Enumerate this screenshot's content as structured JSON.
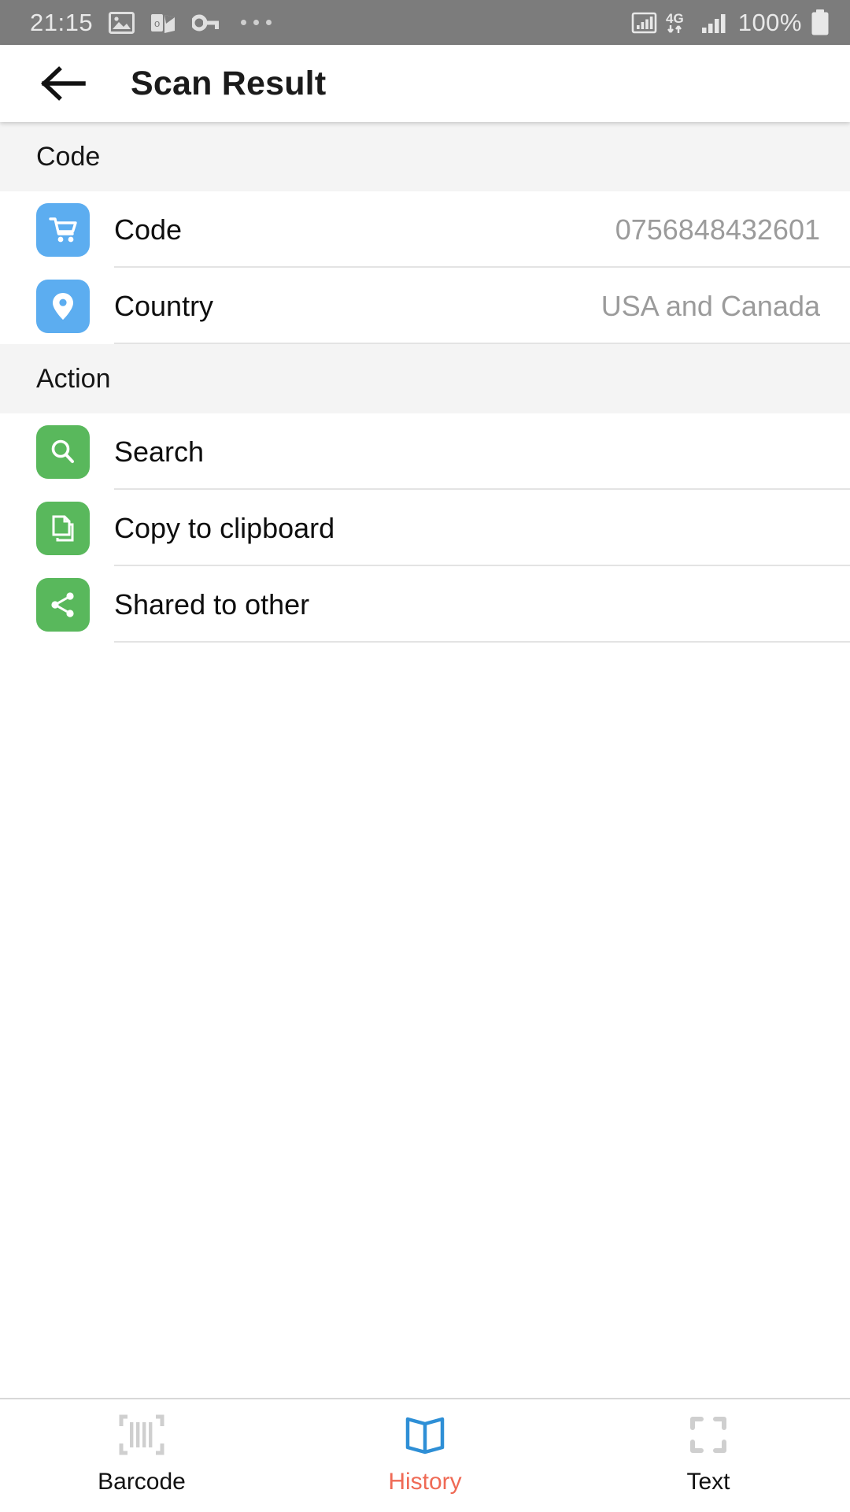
{
  "status_bar": {
    "time": "21:15",
    "battery_percent": "100%",
    "network": "4G",
    "left_icons": [
      "image-icon",
      "outlook-icon",
      "key-icon",
      "overflow-dots-icon"
    ],
    "right_icons": [
      "signal-box-icon",
      "network-4g-icon",
      "signal-bars-icon",
      "battery-icon"
    ]
  },
  "app_bar": {
    "back_label": "back-arrow",
    "title": "Scan Result"
  },
  "sections": [
    {
      "header": "Code",
      "rows": [
        {
          "icon": "shopping-cart-icon",
          "icon_color": "#5cadf0",
          "label": "Code",
          "value": "0756848432601"
        },
        {
          "icon": "location-pin-icon",
          "icon_color": "#5cadf0",
          "label": "Country",
          "value": "USA and Canada"
        }
      ]
    },
    {
      "header": "Action",
      "rows": [
        {
          "icon": "search-icon",
          "icon_color": "#59b85c",
          "label": "Search",
          "value": ""
        },
        {
          "icon": "copy-icon",
          "icon_color": "#59b85c",
          "label": "Copy to clipboard",
          "value": ""
        },
        {
          "icon": "share-icon",
          "icon_color": "#59b85c",
          "label": "Shared to other",
          "value": ""
        }
      ]
    }
  ],
  "bottom_nav": {
    "active": "History",
    "items": [
      {
        "label": "Barcode",
        "icon": "barcode-icon"
      },
      {
        "label": "History",
        "icon": "open-book-icon"
      },
      {
        "label": "Text",
        "icon": "scan-frame-icon"
      }
    ]
  },
  "colors": {
    "accent_blue": "#5cadf0",
    "accent_green": "#59b85c",
    "active_tab": "#ef6a55",
    "history_icon": "#2e8fd6",
    "status_bar_bg": "#7c7c7c",
    "section_bg": "#f4f4f4",
    "value_text": "#9b9b9b"
  }
}
